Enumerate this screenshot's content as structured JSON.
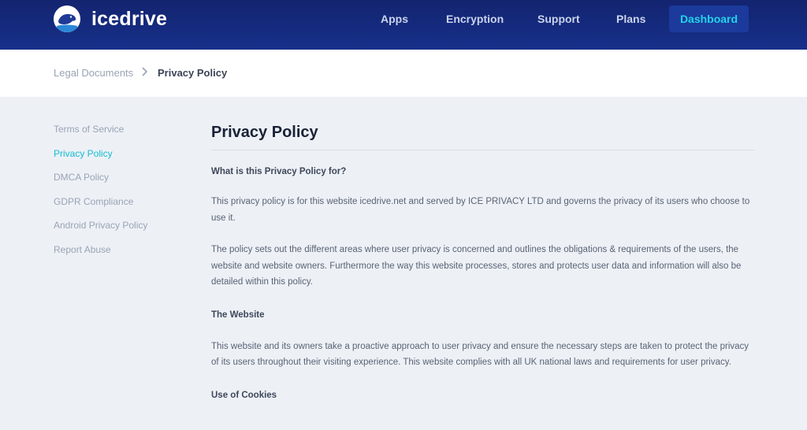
{
  "brand": {
    "name": "icedrive"
  },
  "nav": {
    "items": [
      "Apps",
      "Encryption",
      "Support",
      "Plans"
    ],
    "dashboard_label": "Dashboard"
  },
  "breadcrumb": {
    "parent": "Legal Documents",
    "current": "Privacy Policy"
  },
  "sidebar": {
    "items": [
      {
        "label": "Terms of Service",
        "active": false
      },
      {
        "label": "Privacy Policy",
        "active": true
      },
      {
        "label": "DMCA Policy",
        "active": false
      },
      {
        "label": "GDPR Compliance",
        "active": false
      },
      {
        "label": "Android Privacy Policy",
        "active": false
      },
      {
        "label": "Report Abuse",
        "active": false
      }
    ]
  },
  "article": {
    "title": "Privacy Policy",
    "q1": "What is this Privacy Policy for?",
    "p1": "This privacy policy is for this website icedrive.net and served by ICE PRIVACY LTD and governs the privacy of its users who choose to use it.",
    "p2": "The policy sets out the different areas where user privacy is concerned and outlines the obligations & requirements of the users, the website and website owners. Furthermore the way this website processes, stores and protects user data and information will also be detailed within this policy.",
    "h2": "The Website",
    "p3": "This website and its owners take a proactive approach to user privacy and ensure the necessary steps are taken to protect the privacy of its users throughout their visiting experience. This website complies with all UK national laws and requirements for user privacy.",
    "h3": "Use of Cookies"
  },
  "colors": {
    "header_bg": "#13246f",
    "accent": "#16bcd2",
    "page_bg": "#edf1f6"
  },
  "icons": {
    "logo": "polar-bear-logo-icon",
    "breadcrumb_sep": "chevron-right-icon"
  }
}
